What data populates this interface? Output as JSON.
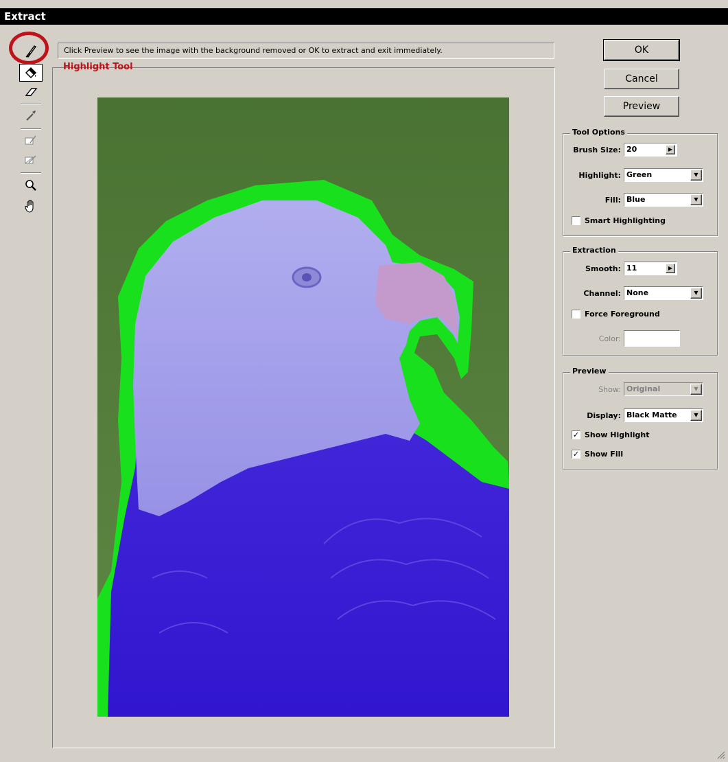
{
  "window": {
    "title": "Extract"
  },
  "hint": "Click Preview to see the image with the background removed or OK to extract and exit immediately.",
  "annotation": {
    "label": "Highlight Tool",
    "color": "#c0121b"
  },
  "toolbar": {
    "tools": [
      "highlighter-tool-icon",
      "fill-tool-icon",
      "eraser-tool-icon",
      "eyedropper-tool-icon",
      "cleanup-tool-icon",
      "edge-touchup-tool-icon",
      "zoom-tool-icon",
      "hand-tool-icon"
    ]
  },
  "buttons": {
    "ok": "OK",
    "cancel": "Cancel",
    "preview": "Preview"
  },
  "tool_options": {
    "title": "Tool Options",
    "brush_size_label": "Brush Size:",
    "brush_size_value": "20",
    "highlight_label": "Highlight:",
    "highlight_value": "Green",
    "fill_label": "Fill:",
    "fill_value": "Blue",
    "smart_highlighting_label": "Smart Highlighting",
    "smart_highlighting_checked": false
  },
  "extraction": {
    "title": "Extraction",
    "smooth_label": "Smooth:",
    "smooth_value": "11",
    "channel_label": "Channel:",
    "channel_value": "None",
    "force_foreground_label": "Force Foreground",
    "force_foreground_checked": false,
    "color_label": "Color:"
  },
  "preview": {
    "title": "Preview",
    "show_label": "Show:",
    "show_value": "Original",
    "display_label": "Display:",
    "display_value": "Black Matte",
    "show_highlight_label": "Show Highlight",
    "show_highlight_checked": true,
    "show_fill_label": "Show Fill",
    "show_fill_checked": true
  },
  "colors": {
    "background": "#4f7a36",
    "highlight": "#18e01c",
    "fill": "#3a21d6",
    "head": "#a7a3ec",
    "beak": "#c99fd0"
  }
}
